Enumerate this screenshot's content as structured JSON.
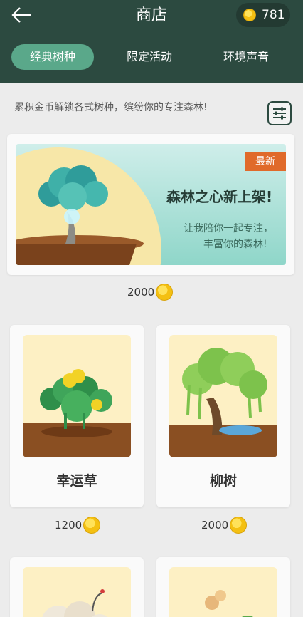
{
  "header": {
    "title": "商店",
    "coin_balance": "781",
    "tabs": [
      {
        "label": "经典树种",
        "active": true
      },
      {
        "label": "限定活动",
        "active": false
      },
      {
        "label": "环境声音",
        "active": false
      }
    ]
  },
  "intro": "累积金币解锁各式树种，缤纷你的专注森林!",
  "banner": {
    "badge": "最新",
    "headline": "森林之心新上架!",
    "line1": "让我陪你一起专注，",
    "line2": "丰富你的森林!",
    "price": "2000"
  },
  "items": [
    {
      "name": "幸运草",
      "price": "1200",
      "icon": "clover"
    },
    {
      "name": "柳树",
      "price": "2000",
      "icon": "willow-tree"
    },
    {
      "name": "",
      "price": "",
      "icon": "crane-clouds"
    },
    {
      "name": "",
      "price": "",
      "icon": "flower-plant"
    }
  ],
  "colors": {
    "header": "#2c4a40",
    "tab_active": "#5aa88a",
    "badge": "#e06a2a",
    "coin": "#f4c012"
  }
}
